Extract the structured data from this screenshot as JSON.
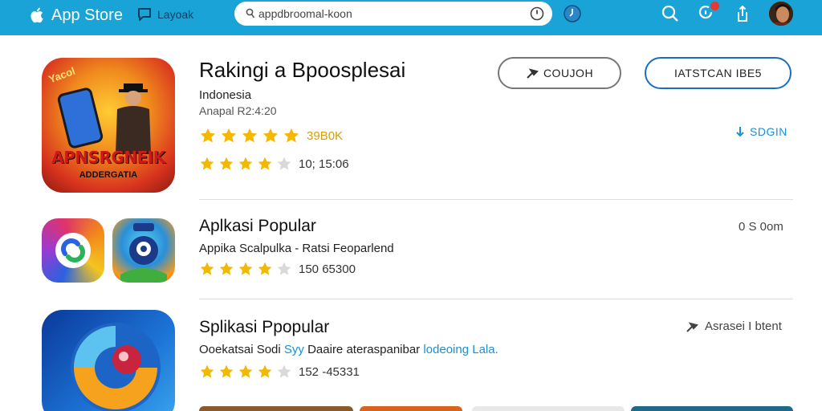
{
  "topbar": {
    "brand": "App Store",
    "layout_link": "Layoak",
    "search_value": "appdbroomal-koon",
    "icons": [
      "apple-logo-icon",
      "chat-bubble-icon",
      "microphone-icon",
      "clock-icon",
      "search-icon",
      "notifications-icon",
      "share-icon",
      "avatar"
    ]
  },
  "featured": {
    "title": "Rakingi a Bpoosplesai",
    "subtitle": "Indonesia",
    "meta": "Anapal R2:4:20",
    "rating_count": "39B0K",
    "rating_count2": "10; 15:06",
    "primary_button": "COUJOH",
    "secondary_button": "IATSTCAN IBE5",
    "download_link": "SDGIN",
    "icon_banner": "APNSRGNEIK",
    "icon_banner_sub": "ADDERGATIA",
    "icon_corner_text": "Yacol"
  },
  "row2": {
    "title": "Aplkasi Popular",
    "subtitle": "Appika Scalpulka - Ratsi Feoparlend",
    "rating_count": "150 65300",
    "right": "0 S 0om"
  },
  "row3": {
    "title": "Splikasi Ppopular",
    "subtitle_a": "Ooekatsai Sodi ",
    "subtitle_hl": "Syy",
    "subtitle_b": " Daaire ateraspanibar ",
    "subtitle_hl2": "lodeoing Lala.",
    "rating_count": "152 -45331",
    "right": "Asrasei I btent"
  },
  "colors": {
    "topbar": "#1aa3d6",
    "star": "#f5b800",
    "star_empty": "#d9d9d9",
    "accent_blue": "#1a8fd6"
  }
}
